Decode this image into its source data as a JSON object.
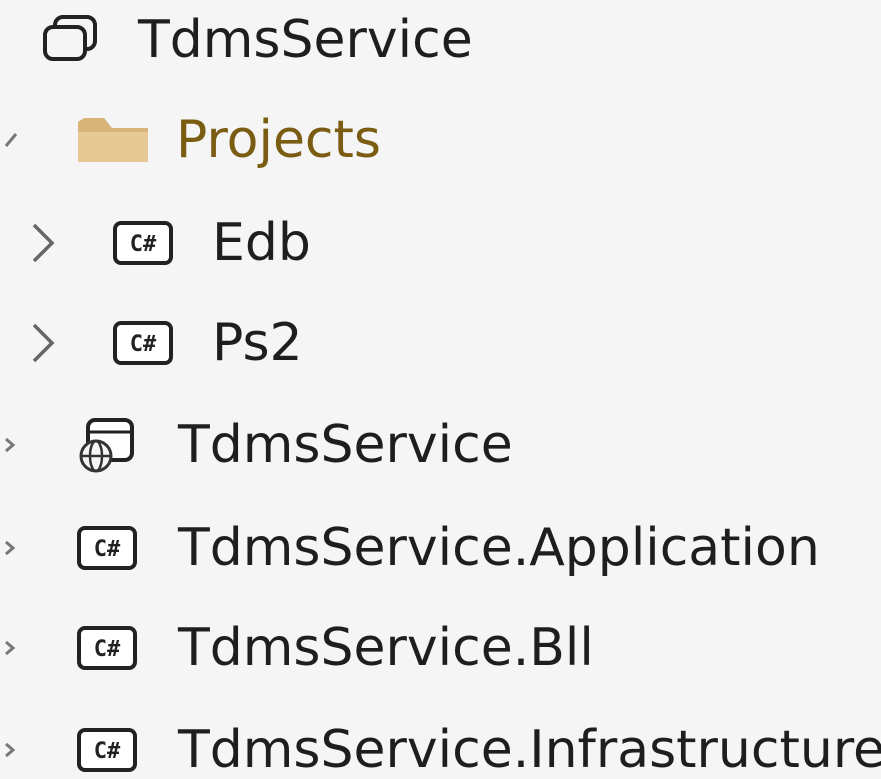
{
  "solution_explorer": {
    "solution": {
      "label": "TdmsService",
      "icon": "solution-icon"
    },
    "projects_folder": {
      "label": "Projects",
      "icon": "folder-icon",
      "expanded": true
    },
    "folder_children": [
      {
        "label": "Edb",
        "icon": "csharp-project-icon",
        "expanded": false
      },
      {
        "label": "Ps2",
        "icon": "csharp-project-icon",
        "expanded": false
      }
    ],
    "projects": [
      {
        "label": "TdmsService",
        "icon": "web-project-icon",
        "expanded": false
      },
      {
        "label": "TdmsService.Application",
        "icon": "csharp-project-icon",
        "expanded": false
      },
      {
        "label": "TdmsService.Bll",
        "icon": "csharp-project-icon",
        "expanded": false
      },
      {
        "label": "TdmsService.Infrastructure",
        "icon": "csharp-project-icon",
        "expanded": false
      }
    ]
  }
}
